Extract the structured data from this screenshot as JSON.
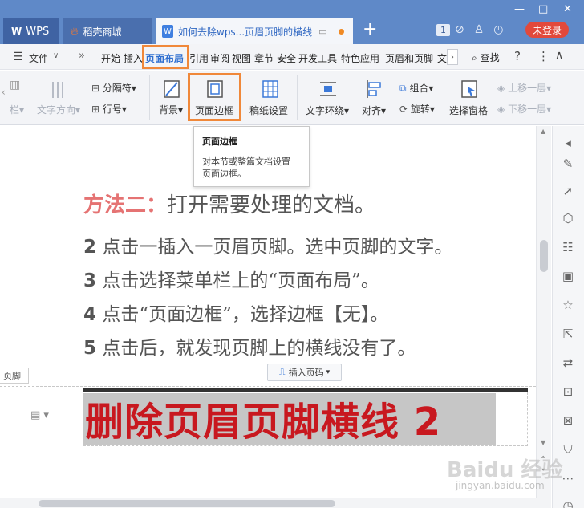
{
  "titlebar": {
    "tab_wps": "WPS",
    "tab_store": "稻壳商城",
    "tab_doc": "如何去除wps...页眉页脚的横线",
    "window_count": "1",
    "login": "未登录"
  },
  "menubar": {
    "file": "文件",
    "items": [
      "开始",
      "插入",
      "页面布局",
      "引用",
      "审阅",
      "视图",
      "章节",
      "安全",
      "开发工具",
      "特色应用",
      "页眉和页脚",
      "文"
    ],
    "search": "查找"
  },
  "ribbon": {
    "bar_partial": "栏",
    "text_direction": "文字方向",
    "separator": "分隔符",
    "line_number": "行号",
    "background": "背景",
    "page_border": "页面边框",
    "grid_paper": "稿纸设置",
    "text_wrap": "文字环绕",
    "align": "对齐",
    "group": "组合",
    "rotate": "旋转",
    "selection_pane": "选择窗格",
    "bring_forward": "上移一层",
    "send_backward": "下移一层"
  },
  "tooltip": {
    "title": "页面边框",
    "desc1": "对本节或整篇文档设置",
    "desc2": "页面边框。"
  },
  "doc": {
    "heading_red": "方法二：",
    "heading_rest": "打开需要处理的文档。",
    "steps": [
      {
        "num": "2",
        "text": " 点击一插入一页眉页脚。选中页脚的文字。"
      },
      {
        "num": "3",
        "text": " 点击选择菜单栏上的“页面布局”。"
      },
      {
        "num": "4",
        "text": " 点击“页面边框”，选择边框【无】。"
      },
      {
        "num": "5",
        "text": " 点击后，就发现页脚上的横线没有了。"
      }
    ],
    "footer_tag": "页脚",
    "insert_page_number": "插入页码",
    "footer_text": "删除页眉页脚横线 2"
  },
  "watermark": {
    "main": "Baidu 经验",
    "sub": "jingyan.baidu.com"
  },
  "colors": {
    "titlebar": "#5f89c8",
    "highlight": "#f0883a",
    "accent_blue": "#2f6fd0",
    "footer_red": "#c8181f",
    "login_red": "#e2493b"
  }
}
